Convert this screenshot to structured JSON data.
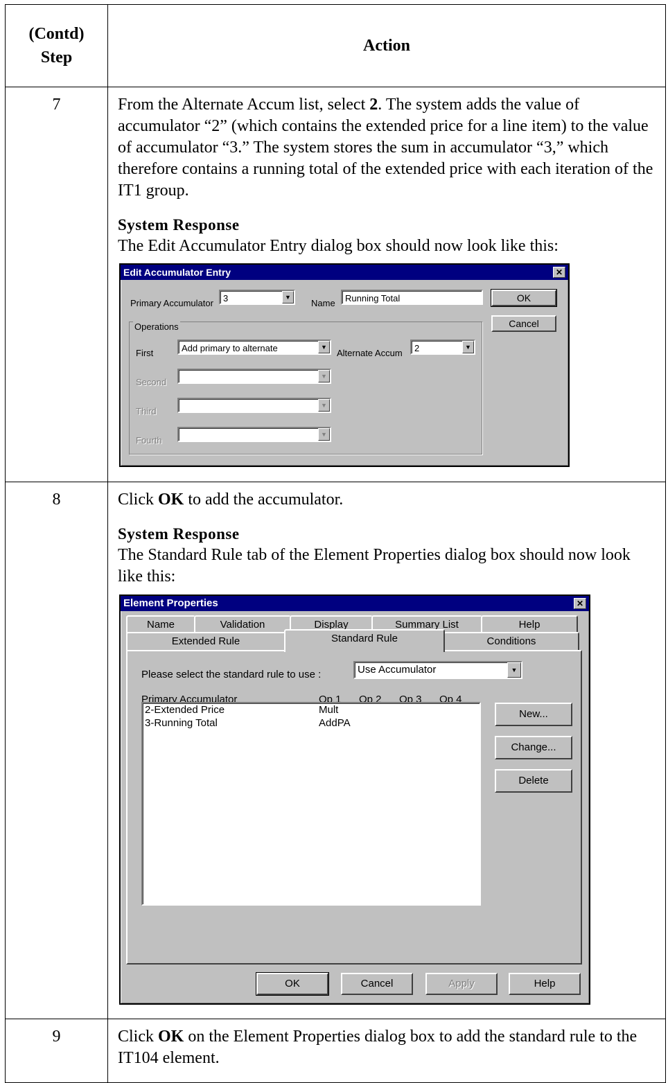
{
  "header": {
    "step_label_line1": "(Contd)",
    "step_label_line2": "Step",
    "action_label": "Action"
  },
  "step7": {
    "number": "7",
    "text_pre": "From the Alternate Accum list, select ",
    "text_bold": "2",
    "text_post": ". The system adds the value of accumulator “2” (which contains the extended price for a line item) to the value of accumulator “3.” The system stores the sum in accumulator “3,” which therefore contains a running total of the extended price with each iteration of the IT1 group.",
    "response_heading": "System Response",
    "response_text": "The Edit Accumulator Entry dialog box should now look like this:"
  },
  "edit_dialog": {
    "title": "Edit Accumulator Entry",
    "primary_label": "Primary Accumulator",
    "primary_value": "3",
    "name_label": "Name",
    "name_value": "Running Total",
    "ok_label": "OK",
    "cancel_label": "Cancel",
    "operations_label": "Operations",
    "first_label": "First",
    "first_value": "Add primary to alternate",
    "alternate_label": "Alternate Accum",
    "alternate_value": "2",
    "second_label": "Second",
    "third_label": "Third",
    "fourth_label": "Fourth"
  },
  "step8": {
    "number": "8",
    "text_pre": "Click ",
    "text_bold": "OK",
    "text_post": " to add the accumulator.",
    "response_heading": "System Response",
    "response_text": "The Standard Rule tab of the Element Properties dialog box should now look like this:"
  },
  "props_dialog": {
    "title": "Element Properties",
    "tabs_row1": [
      "Name",
      "Validation",
      "Display",
      "Summary List",
      "Help"
    ],
    "tabs_row2": [
      "Extended Rule",
      "Standard Rule",
      "Conditions"
    ],
    "select_label": "Please select the standard rule to use :",
    "select_value": "Use Accumulator",
    "col_primary": "Primary Accumulator",
    "col_op1": "Op 1",
    "col_op2": "Op 2",
    "col_op3": "Op 3",
    "col_op4": "Op 4",
    "rows": [
      {
        "name": "2-Extended Price",
        "op1": "Mult"
      },
      {
        "name": "3-Running Total",
        "op1": "AddPA"
      }
    ],
    "new_label": "New...",
    "change_label": "Change...",
    "delete_label": "Delete",
    "ok_label": "OK",
    "cancel_label": "Cancel",
    "apply_label": "Apply",
    "help_label": "Help"
  },
  "step9": {
    "number": "9",
    "text_pre": "Click ",
    "text_bold": "OK",
    "text_post": " on the Element Properties dialog box to add the standard rule to the IT104 element."
  }
}
